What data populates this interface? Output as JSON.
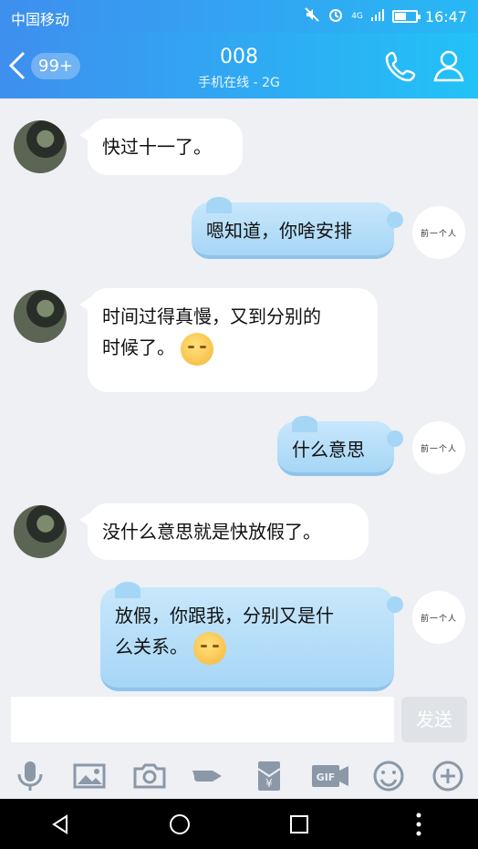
{
  "status_bar": {
    "carrier": "中国移动",
    "network": "4G",
    "time": "16:47"
  },
  "header": {
    "back_badge": "99+",
    "title": "008",
    "subtitle": "手机在线 - 2G"
  },
  "messages": [
    {
      "side": "left",
      "text": "快过十一了。"
    },
    {
      "side": "right",
      "text": "嗯知道，你啥安排"
    },
    {
      "side": "left",
      "text_line1": "时间过得真慢，又到分别的",
      "text_line2": "时候了。",
      "emoji": "pensive-face"
    },
    {
      "side": "right",
      "text": "什么意思"
    },
    {
      "side": "left",
      "text": "没什么意思就是快放假了。"
    },
    {
      "side": "right",
      "text_line1": "放假，你跟我，分别又是什",
      "text_line2": "么关系。",
      "emoji": "sweat-face"
    }
  ],
  "my_avatar_text": "前一个人",
  "input": {
    "value": "",
    "send_label": "发送"
  },
  "toolbar": [
    "mic-icon",
    "image-icon",
    "camera-icon",
    "poke-icon",
    "red-packet-icon",
    "gif-icon",
    "emoji-icon",
    "plus-icon"
  ],
  "toolbar_labels": {
    "gif": "GIF",
    "yuan": "¥"
  }
}
